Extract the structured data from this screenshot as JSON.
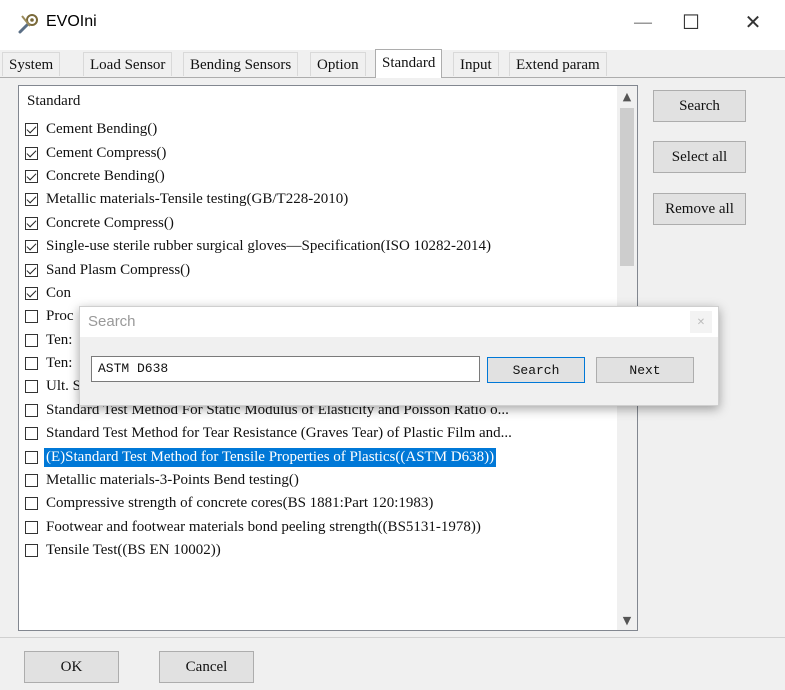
{
  "window": {
    "title": "EVOIni",
    "app_icon": "wrench-gear-icon",
    "controls": {
      "minimize": "—",
      "maximize": "☐",
      "close": "✕"
    }
  },
  "tabs": [
    {
      "label": "System",
      "active": false
    },
    {
      "label": "Load Sensor",
      "active": false
    },
    {
      "label": "Bending Sensors",
      "active": false
    },
    {
      "label": "Option",
      "active": false
    },
    {
      "label": "Standard",
      "active": true
    },
    {
      "label": "Input",
      "active": false
    },
    {
      "label": "Extend param",
      "active": false
    }
  ],
  "list": {
    "header": "Standard",
    "items": [
      {
        "label": "Cement Bending()",
        "checked": true
      },
      {
        "label": "Cement Compress()",
        "checked": true
      },
      {
        "label": "Concrete Bending()",
        "checked": true
      },
      {
        "label": "Metallic materials-Tensile testing(GB/T228-2010)",
        "checked": true
      },
      {
        "label": "Concrete Compress()",
        "checked": true
      },
      {
        "label": "Single-use sterile rubber surgical gloves—Specification(ISO 10282-2014)",
        "checked": true
      },
      {
        "label": "Sand Plasm Compress()",
        "checked": true
      },
      {
        "label": "Con",
        "checked": true
      },
      {
        "label": "Proc",
        "checked": false
      },
      {
        "label": "Ten:",
        "checked": false
      },
      {
        "label": "Ten:",
        "checked": false
      },
      {
        "label": "Ult. Str. of Coupler(BS8110/GS/COP)",
        "checked": false
      },
      {
        "label": "Standard Test Method For Static Modulus of Elasticity and Poisson Ratio o...",
        "checked": false
      },
      {
        "label": "Standard Test Method for Tear Resistance (Graves Tear) of Plastic Film and...",
        "checked": false
      },
      {
        "label": "(E)Standard Test Method for Tensile Properties of Plastics((ASTM D638))",
        "checked": false,
        "selected": true
      },
      {
        "label": "Metallic materials-3-Points Bend testing()",
        "checked": false
      },
      {
        "label": "Compressive strength of concrete cores(BS 1881:Part 120:1983)",
        "checked": false
      },
      {
        "label": "Footwear and footwear materials bond peeling strength((BS5131-1978))",
        "checked": false
      },
      {
        "label": "Tensile Test((BS EN 10002))",
        "checked": false
      }
    ]
  },
  "side_buttons": {
    "search": "Search",
    "select_all": "Select all",
    "remove_all": "Remove all"
  },
  "search_dialog": {
    "title": "Search",
    "close": "✕",
    "input_value": "ASTM D638",
    "search_label": "Search",
    "next_label": "Next"
  },
  "footer": {
    "ok": "OK",
    "cancel": "Cancel"
  },
  "colors": {
    "selection": "#0078d7",
    "window_bg": "#f0f0f0"
  }
}
